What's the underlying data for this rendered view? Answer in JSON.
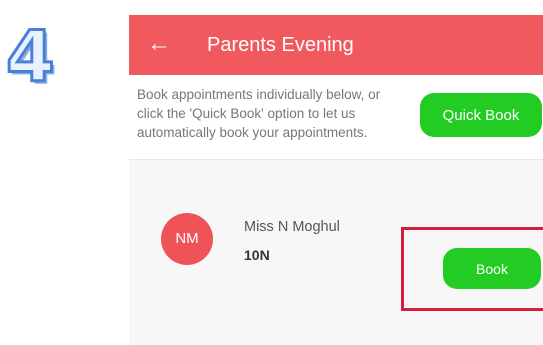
{
  "step": {
    "number": "4"
  },
  "header": {
    "back_icon": "arrow-left-icon",
    "title": "Parents Evening"
  },
  "intro": {
    "text": "Book appointments individually below, or click the 'Quick Book' option to let us automatically book your appointments.",
    "quick_book_label": "Quick Book"
  },
  "teacher": {
    "initials": "NM",
    "name": "Miss N Moghul",
    "class": "10N",
    "book_label": "Book"
  },
  "colors": {
    "header": "#f05a5e",
    "button_green": "#22cc22",
    "avatar_red": "#ef5358",
    "highlight_border": "#d11f3c",
    "step_number": "#4a7fd6"
  }
}
